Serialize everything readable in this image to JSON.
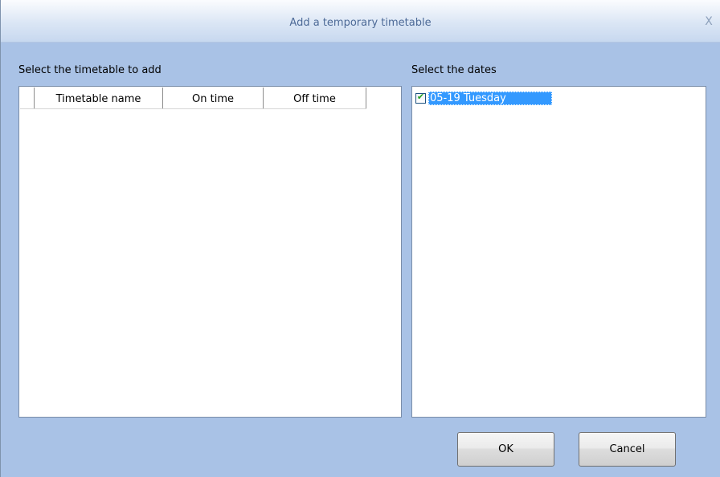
{
  "window": {
    "title": "Add a temporary timetable",
    "close_glyph": "X"
  },
  "timetable": {
    "label": "Select the timetable to add",
    "columns": [
      "",
      "Timetable name",
      "On time",
      "Off time"
    ],
    "rows": []
  },
  "dates": {
    "label": "Select the dates",
    "items": [
      {
        "label": "05-19 Tuesday",
        "checked": true,
        "selected": true
      }
    ]
  },
  "buttons": {
    "ok_label": "OK",
    "cancel_label": "Cancel"
  },
  "colors": {
    "window_bg": "#a9c2e6",
    "selection": "#3399ff",
    "title_text": "#4d6a97"
  }
}
